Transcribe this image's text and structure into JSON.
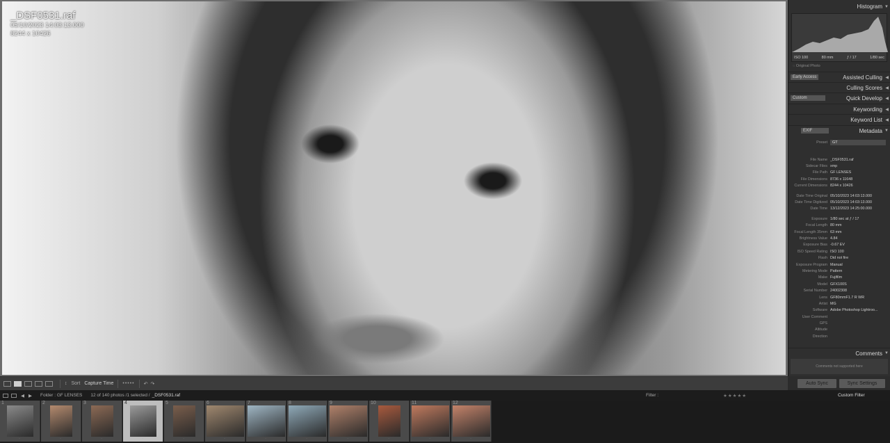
{
  "photo": {
    "file_name": "_DSF0531.raf",
    "datetime": "05/10/2023 14:03:13.000",
    "dimensions": "8244 x 10426"
  },
  "toolbar": {
    "sort_label": "Sort",
    "sort_value": "Capture Time"
  },
  "panels": {
    "histogram": "Histogram",
    "assisted_culling": "Assisted Culling",
    "early_access": "Early Access",
    "culling_scores": "Culling Scores",
    "quick_develop": "Quick Develop",
    "quick_develop_preset": "Custom",
    "keywording": "Keywording",
    "keyword_list": "Keyword List",
    "metadata": "Metadata",
    "metadata_mode": "EXIF",
    "comments": "Comments",
    "comments_placeholder": "Comments not supported here"
  },
  "histogram": {
    "iso": "ISO 100",
    "focal": "80 mm",
    "aperture": "ƒ / 17",
    "shutter": "1/80 sec",
    "original_photo": "Original Photo"
  },
  "metadata": {
    "preset_label": "Preset",
    "preset_value": "GT",
    "rows": [
      {
        "k": "File Name",
        "v": "_DSF0531.raf"
      },
      {
        "k": "Sidecar Files",
        "v": "xmp"
      },
      {
        "k": "File Path",
        "v": "GF LENSES"
      },
      {
        "k": "File Dimensions",
        "v": "8736 x 11648"
      },
      {
        "k": "Current Dimensions",
        "v": "8244 x 10426"
      },
      {
        "k": "",
        "v": ""
      },
      {
        "k": "Date Time Original",
        "v": "05/10/2023 14:03:13.000"
      },
      {
        "k": "Date Time Digitized",
        "v": "05/10/2023 14:03:13.000"
      },
      {
        "k": "Date Time",
        "v": "13/12/2023 14:25:00.000"
      },
      {
        "k": "",
        "v": ""
      },
      {
        "k": "Exposure",
        "v": "1/80 sec at ƒ / 17"
      },
      {
        "k": "Focal Length",
        "v": "80 mm"
      },
      {
        "k": "Focal Length 35mm",
        "v": "63 mm"
      },
      {
        "k": "Brightness Value",
        "v": "4.84"
      },
      {
        "k": "Exposure Bias",
        "v": "-0.67 EV"
      },
      {
        "k": "ISO Speed Rating",
        "v": "ISO 100"
      },
      {
        "k": "Flash",
        "v": "Did not fire"
      },
      {
        "k": "Exposure Program",
        "v": "Manual"
      },
      {
        "k": "Metering Mode",
        "v": "Pattern"
      },
      {
        "k": "Make",
        "v": "Fujifilm"
      },
      {
        "k": "Model",
        "v": "GFX100S"
      },
      {
        "k": "Serial Number",
        "v": "24002308"
      },
      {
        "k": "Lens",
        "v": "GF80mmF1.7 R WR"
      },
      {
        "k": "Artist",
        "v": "MG"
      },
      {
        "k": "Software",
        "v": "Adobe Photoshop Lightroo..."
      },
      {
        "k": "User Comment",
        "v": ""
      },
      {
        "k": "GPS",
        "v": ""
      },
      {
        "k": "Altitude",
        "v": ""
      },
      {
        "k": "Direction",
        "v": ""
      }
    ]
  },
  "sync": {
    "auto_sync": "Auto Sync",
    "sync_settings": "Sync Settings"
  },
  "filmstrip_header": {
    "folder": "Folder : GF LENSES",
    "count": "12 of 140 photos /1 selected /",
    "selected_name": "_DSF0531.raf",
    "filter_label": "Filter :",
    "filter_value": "Custom Filter"
  },
  "filmstrip": {
    "cells": [
      {
        "n": "1",
        "tone": "#8a8a8a",
        "tw": 38
      },
      {
        "n": "2",
        "tone": "#b48a6e",
        "tw": 32
      },
      {
        "n": "3",
        "tone": "#8c6a55",
        "tw": 32
      },
      {
        "n": "4",
        "tone": "#9a9a9a",
        "tw": 38,
        "sel": true
      },
      {
        "n": "5",
        "tone": "#7a5e4c",
        "tw": 32
      },
      {
        "n": "6",
        "tone": "#a0886f",
        "tw": 54
      },
      {
        "n": "7",
        "tone": "#9fb6c4",
        "tw": 54
      },
      {
        "n": "8",
        "tone": "#8fa9b8",
        "tw": 54
      },
      {
        "n": "9",
        "tone": "#b0816a",
        "tw": 54
      },
      {
        "n": "10",
        "tone": "#a85a3e",
        "tw": 32
      },
      {
        "n": "11",
        "tone": "#c07a5e",
        "tw": 54
      },
      {
        "n": "12",
        "tone": "#c4836a",
        "tw": 54
      }
    ]
  }
}
